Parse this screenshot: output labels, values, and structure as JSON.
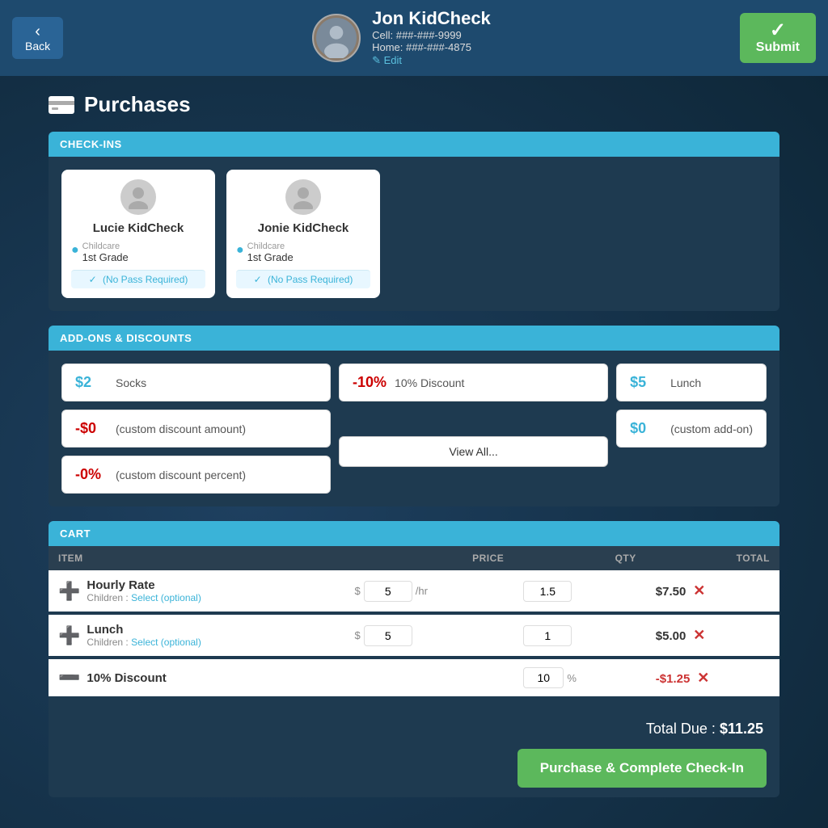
{
  "header": {
    "back_label": "Back",
    "submit_label": "Submit",
    "user": {
      "name": "Jon KidCheck",
      "cell": "Cell: ###-###-9999",
      "home": "Home: ###-###-4875",
      "edit_label": "✎ Edit"
    }
  },
  "page_title": "Purchases",
  "sections": {
    "checkins": {
      "label": "CHECK-INS",
      "children": [
        {
          "name": "Lucie KidCheck",
          "location_label": "Childcare",
          "location_grade": "1st Grade",
          "pass": "(No Pass Required)"
        },
        {
          "name": "Jonie KidCheck",
          "location_label": "Childcare",
          "location_grade": "1st Grade",
          "pass": "(No Pass Required)"
        }
      ]
    },
    "addons": {
      "label": "ADD-ONS & DISCOUNTS",
      "items": [
        {
          "price": "$2",
          "label": "Socks",
          "negative": false
        },
        {
          "price": "-10%",
          "label": "10% Discount",
          "negative": true
        },
        {
          "price": "$5",
          "label": "Lunch",
          "negative": false
        },
        {
          "price": "-$0",
          "label": "(custom discount amount)",
          "negative": true
        },
        {
          "price": "$0",
          "label": "(custom add-on)",
          "negative": false
        },
        {
          "price": "-0%",
          "label": "(custom discount percent)",
          "negative": true
        }
      ],
      "view_all_label": "View All..."
    },
    "cart": {
      "label": "CART",
      "columns": {
        "item": "ITEM",
        "price": "PRICE",
        "qty": "QTY",
        "total": "TOTAL"
      },
      "rows": [
        {
          "type": "add",
          "name": "Hourly Rate",
          "children_label": "Children :",
          "select_label": "Select (optional)",
          "price_symbol": "$",
          "price_value": "5",
          "rate_label": "/hr",
          "qty_value": "1.5",
          "total": "$7.50"
        },
        {
          "type": "add",
          "name": "Lunch",
          "children_label": "Children :",
          "select_label": "Select (optional)",
          "price_symbol": "$",
          "price_value": "5",
          "rate_label": "",
          "qty_value": "1",
          "total": "$5.00"
        },
        {
          "type": "discount",
          "name": "10% Discount",
          "percent_value": "10",
          "percent_symbol": "%",
          "total": "-$1.25"
        }
      ],
      "total_due_label": "Total Due :",
      "total_due_value": "$11.25"
    }
  },
  "purchase_btn_label": "Purchase & Complete Check-In"
}
